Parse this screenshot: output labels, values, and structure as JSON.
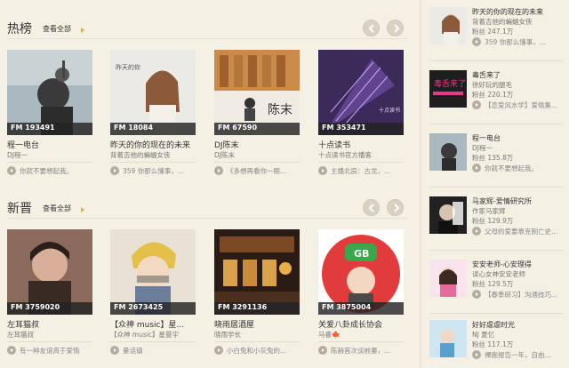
{
  "hot": {
    "title": "热榜",
    "see_all": "查看全部",
    "cards": [
      {
        "fm": "FM 193491",
        "name": "程一电台",
        "sub": "DJ程一",
        "latest": "你就不要想起我。"
      },
      {
        "fm": "FM 18084",
        "name": "昨天的你的现在的未来",
        "sub": "背着吉他的蝙蝠女侠",
        "latest": "359 你那么懂事，..."
      },
      {
        "fm": "FM 67590",
        "name": "DJ陈末",
        "sub": "DJ陈末",
        "latest": "《多想再看你一眼..."
      },
      {
        "fm": "FM 353471",
        "name": "十点读书",
        "sub": "十点读书官方播客",
        "latest": "主播北辰：古龙，..."
      }
    ]
  },
  "new": {
    "title": "新晋",
    "see_all": "查看全部",
    "cards": [
      {
        "fm": "FM 3759020",
        "name": "左耳猫叔",
        "sub": "左耳猫叔",
        "latest": "有一种友谊高于爱情"
      },
      {
        "fm": "FM 2673425",
        "name": "【众神 music】星...",
        "sub": "【众神 music】星曼宇",
        "latest": "量话镇"
      },
      {
        "fm": "FM 3291136",
        "name": "晓雨居酒屋",
        "sub": "晓雨学长",
        "latest": "小白兔和小灰兔的..."
      },
      {
        "fm": "FM 3875004",
        "name": "关爱八卦成长协会",
        "sub": "马睿🍁",
        "latest": "陈赫首次谈前妻，..."
      }
    ]
  },
  "sidebar": {
    "fans_label": "粉丝",
    "items": [
      {
        "name": "昨天的你的现在的未来",
        "sub": "背着吉他的蝙蝠女侠",
        "fans": "247.1万",
        "latest": "359 你那么懂事，..."
      },
      {
        "name": "毒舌来了",
        "sub": "徐好玩的腿毛",
        "fans": "220.1万",
        "latest": "【恋爱风水学】爱情集..."
      },
      {
        "name": "程一电台",
        "sub": "DJ程一",
        "fans": "135.8万",
        "latest": "你就不要想起我。"
      },
      {
        "name": "马家辉-爱情研究所",
        "sub": "作家马家辉",
        "fans": "129.9万",
        "latest": "父母的爱要靠克制亡史..."
      },
      {
        "name": "安安老师-心安理得",
        "sub": "读心女神安安老师",
        "fans": "129.5万",
        "latest": "【春季研习】沟通技巧..."
      },
      {
        "name": "好好虐虐时光",
        "sub": "NJ 夏忆",
        "fans": "117.1万",
        "latest": "裸跑报告一年，自由..."
      }
    ]
  },
  "cover_texts": {
    "chenmo": "陈末",
    "gb": "GB",
    "ten_oclock": "十点读书",
    "dushe": "毒舌来了"
  },
  "colors": {
    "background": "#f4f0e4",
    "accent_arrow": "#f5a623",
    "fm_bar": "#232323"
  }
}
